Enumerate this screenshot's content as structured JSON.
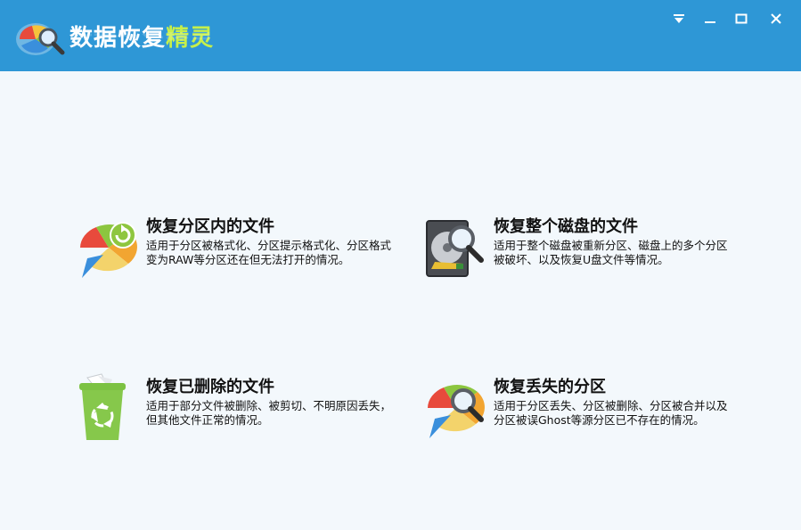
{
  "app": {
    "title_main": "数据恢复",
    "title_accent": "精灵"
  },
  "window_controls": {
    "menu_icon": "dropdown-menu-icon",
    "minimize_icon": "minimize-icon",
    "maximize_icon": "maximize-icon",
    "close_icon": "close-icon"
  },
  "options": [
    {
      "id": "partition-files",
      "title": "恢复分区内的文件",
      "description": "适用于分区被格式化、分区提示格式化、分区格式变为RAW等分区还在但无法打开的情况。",
      "icon": "pie-chart-refresh-icon"
    },
    {
      "id": "whole-disk",
      "title": "恢复整个磁盘的文件",
      "description": "适用于整个磁盘被重新分区、磁盘上的多个分区被破坏、以及恢复U盘文件等情况。",
      "icon": "hard-disk-magnifier-icon"
    },
    {
      "id": "deleted-files",
      "title": "恢复已删除的文件",
      "description": "适用于部分文件被删除、被剪切、不明原因丢失，但其他文件正常的情况。",
      "icon": "recycle-bin-icon"
    },
    {
      "id": "lost-partition",
      "title": "恢复丢失的分区",
      "description": "适用于分区丢失、分区被删除、分区被合并以及分区被误Ghost等源分区已不存在的情况。",
      "icon": "pie-chart-magnifier-icon"
    }
  ],
  "colors": {
    "titlebar": "#2e97d6",
    "background": "#f3f8fc",
    "accent_green": "#c6f04a"
  }
}
